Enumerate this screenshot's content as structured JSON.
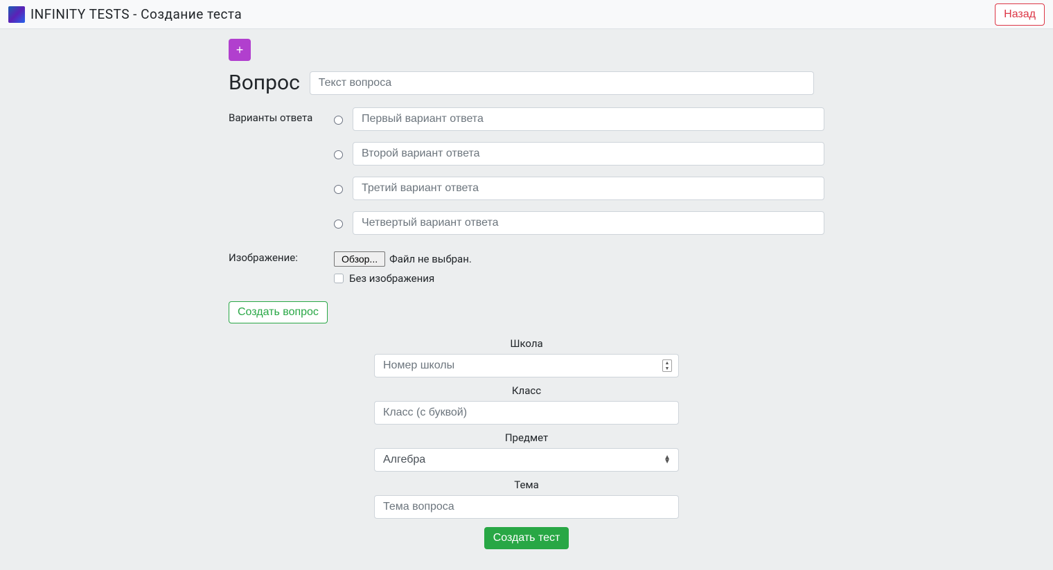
{
  "navbar": {
    "title": "INFINITY TESTS - Создание теста",
    "back_label": "Назад"
  },
  "question": {
    "add_btn": "+",
    "label": "Вопрос",
    "placeholder": "Текст вопроса",
    "answers_label": "Варианты ответа",
    "answers": [
      {
        "placeholder": "Первый вариант ответа"
      },
      {
        "placeholder": "Второй вариант ответа"
      },
      {
        "placeholder": "Третий вариант ответа"
      },
      {
        "placeholder": "Четвертый вариант ответа"
      }
    ],
    "image_label": "Изображение:",
    "browse_label": "Обзор...",
    "file_status": "Файл не выбран.",
    "no_image_label": "Без изображения",
    "create_question_label": "Создать вопрос"
  },
  "meta": {
    "school_label": "Школа",
    "school_placeholder": "Номер школы",
    "class_label": "Класс",
    "class_placeholder": "Класс (с буквой)",
    "subject_label": "Предмет",
    "subject_value": "Алгебра",
    "topic_label": "Тема",
    "topic_placeholder": "Тема вопроса",
    "submit_label": "Создать тест"
  }
}
